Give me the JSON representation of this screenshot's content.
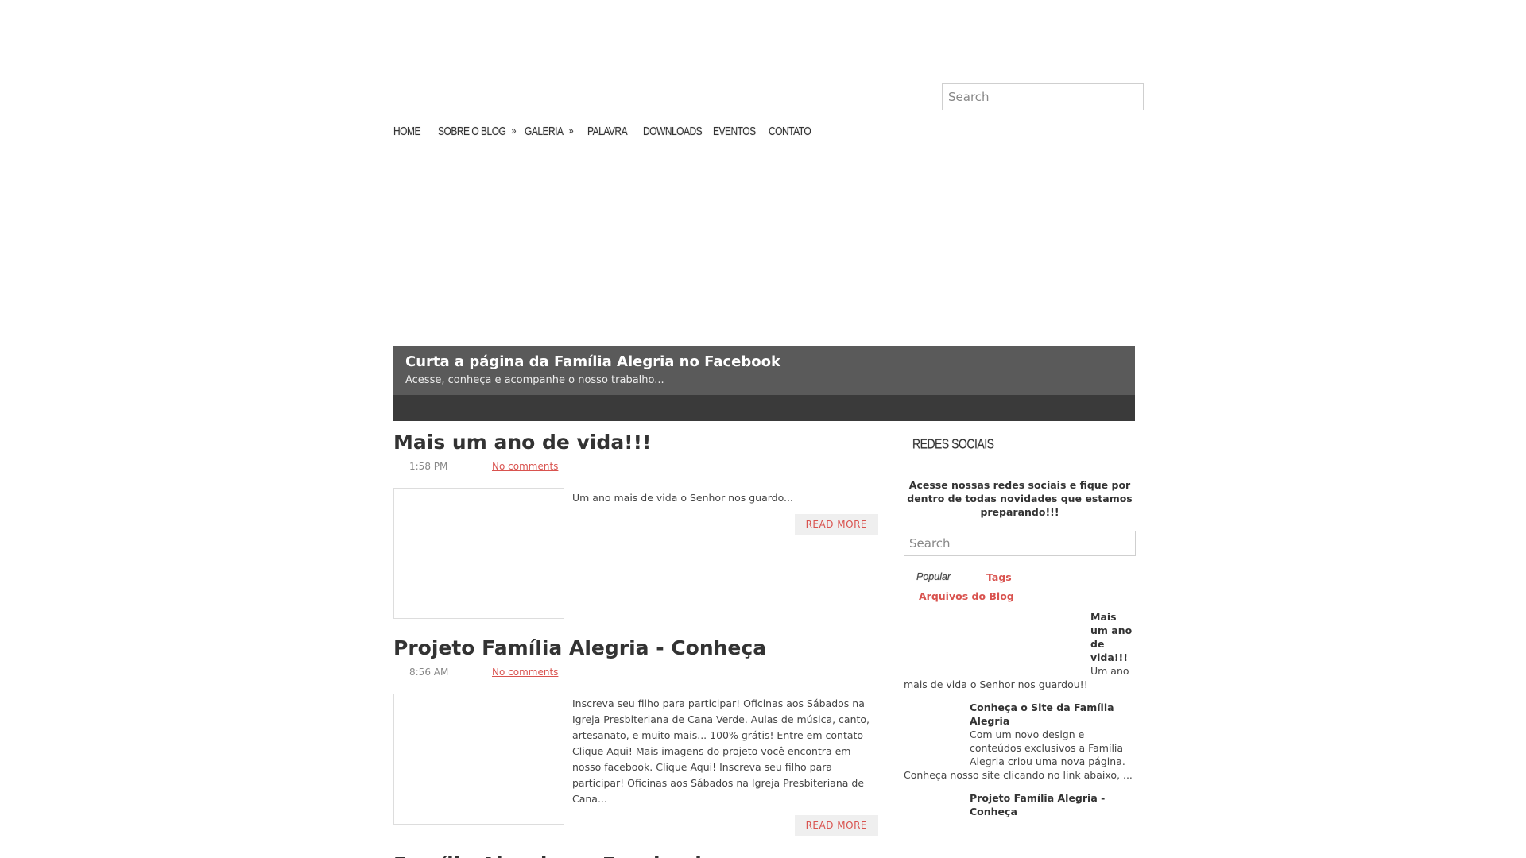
{
  "header": {
    "search_placeholder": "Search"
  },
  "nav": {
    "items": [
      {
        "label": "HOME",
        "has_sub": false
      },
      {
        "label": "SOBRE O BLOG",
        "has_sub": true
      },
      {
        "label": "GALERIA",
        "has_sub": true
      },
      {
        "label": "PALAVRA",
        "has_sub": false
      },
      {
        "label": "DOWNLOADS",
        "has_sub": false
      },
      {
        "label": "EVENTOS",
        "has_sub": false
      },
      {
        "label": "CONTATO",
        "has_sub": false
      }
    ],
    "arrow": "»"
  },
  "banner": {
    "title": "Curta a página da Família Alegria no Facebook",
    "subtitle": "Acesse, conheça e acompanhe o nosso trabalho..."
  },
  "posts": [
    {
      "title": "Mais um ano de vida!!!",
      "time": "1:58 PM",
      "comments": "No comments",
      "excerpt": "Um ano mais de vida o Senhor nos guardo...",
      "read_more": "READ MORE"
    },
    {
      "title": "Projeto Família Alegria - Conheça",
      "time": "8:56 AM",
      "comments": "No comments",
      "excerpt": "Inscreva seu filho para participar! Oficinas aos Sábados na Igreja Presbiteriana de Cana Verde. Aulas de música, canto, artesanato, e muito mais... 100% grátis!  Entre em contato Clique Aqui! Mais imagens do projeto você encontra em nosso facebook. Clique Aqui!  Inscreva seu filho para participar! Oficinas aos Sábados na Igreja Presbiteriana de Cana...",
      "read_more": "READ MORE"
    },
    {
      "title": "Família Alegria no Facebook"
    }
  ],
  "sidebar": {
    "widget_title": "REDES SOCIAIS",
    "widget_text": "Acesse nossas redes sociais e fique por dentro de todas novidades que estamos preparando!!!",
    "search_placeholder": "Search",
    "tabs": {
      "popular": "Popular",
      "tags": "Tags",
      "archives": "Arquivos do Blog"
    },
    "popular": [
      {
        "title": "Mais um ano de vida!!!",
        "snippet": "Um ano mais de vida o Senhor nos guardou!!"
      },
      {
        "title": "Conheça o Site da Família Alegria",
        "snippet": "Com um novo design e conteúdos exclusivos  a Família Alegria criou uma nova página.  Conheça nosso site clicando no link abaixo, ..."
      },
      {
        "title": "Projeto Família Alegria - Conheça",
        "snippet": ""
      }
    ]
  }
}
